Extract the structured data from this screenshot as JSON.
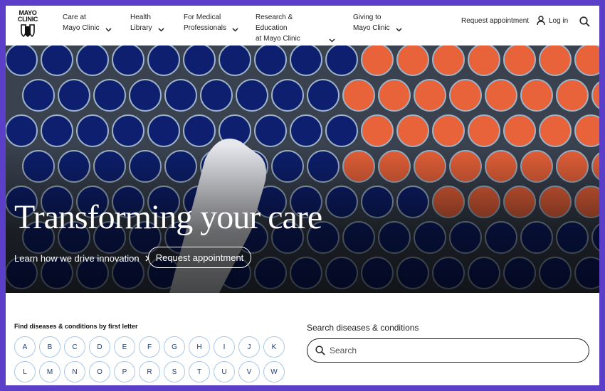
{
  "header": {
    "logo_line1": "MAYO",
    "logo_line2": "CLINIC",
    "nav": [
      {
        "line1": "Care at",
        "line2": "Mayo Clinic"
      },
      {
        "line1": "Health",
        "line2": "Library"
      },
      {
        "line1": "For Medical",
        "line2": "Professionals"
      },
      {
        "line1": "Research & Education",
        "line2": "at Mayo Clinic"
      },
      {
        "line1": "Giving to",
        "line2": "Mayo Clinic"
      }
    ],
    "request_appointment": "Request appointment",
    "login": "Log in",
    "icons": {
      "login": "user-icon",
      "search": "search-icon",
      "chevron": "chevron-down-icon"
    }
  },
  "hero": {
    "title": "Transforming your care",
    "link_label": "Learn how we drive innovation",
    "button_label": "Request appointment"
  },
  "conditions": {
    "find_label": "Find diseases & conditions by first letter",
    "letters_row1": [
      "A",
      "B",
      "C",
      "D",
      "E",
      "F",
      "G",
      "H",
      "I",
      "J",
      "K"
    ],
    "letters_row2": [
      "L",
      "M",
      "N",
      "O",
      "P",
      "R",
      "S",
      "T",
      "U",
      "V",
      "W"
    ],
    "search_label": "Search diseases & conditions",
    "search_placeholder": "Search"
  },
  "colors": {
    "frame_border": "#5b3fc8",
    "letter_border": "#a9c7e6",
    "letter_text": "#1d3f73"
  }
}
